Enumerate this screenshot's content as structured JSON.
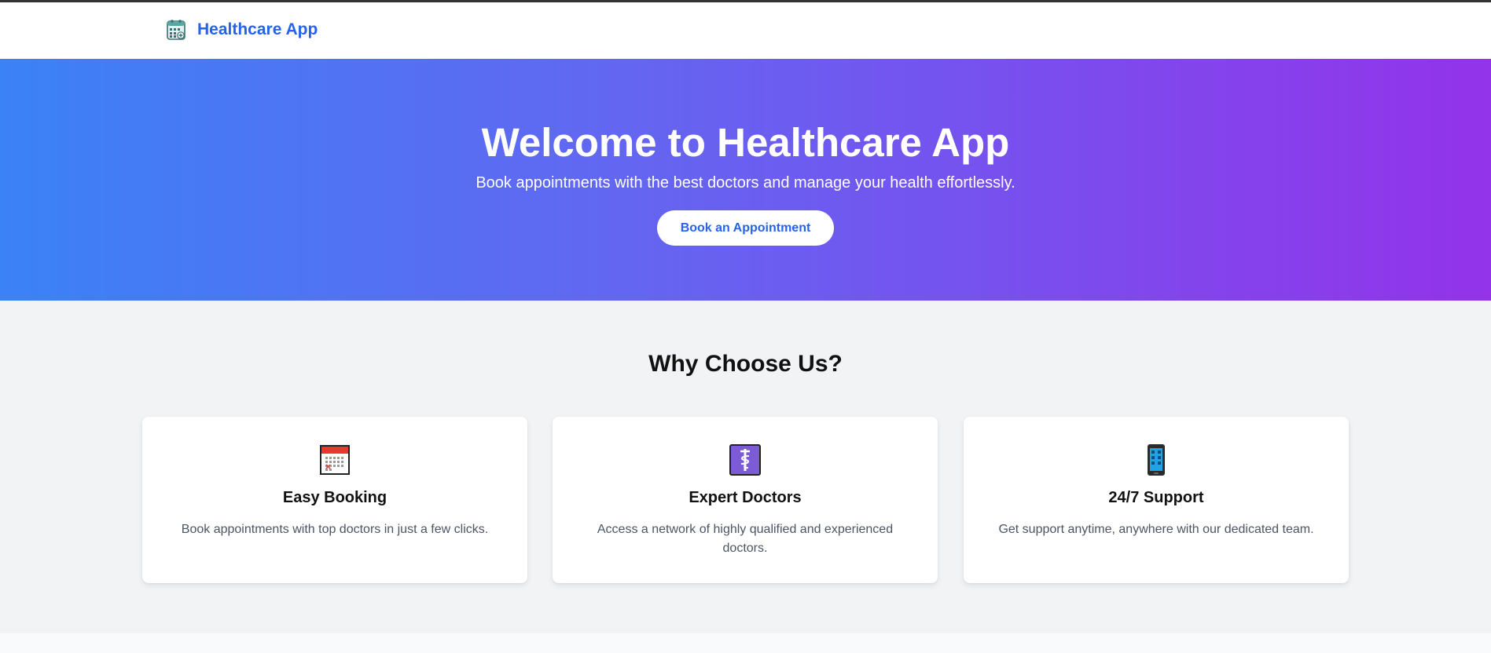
{
  "header": {
    "brand_name": "Healthcare App",
    "brand_icon": "hospital-calendar-icon"
  },
  "hero": {
    "title": "Welcome to Healthcare App",
    "subtitle": "Book appointments with the best doctors and manage your health effortlessly.",
    "cta_label": "Book an Appointment",
    "gradient_start": "#3b82f6",
    "gradient_end": "#9333ea"
  },
  "features": {
    "title": "Why Choose Us?",
    "items": [
      {
        "icon": "calendar-icon",
        "title": "Easy Booking",
        "text": "Book appointments with top doctors in just a few clicks."
      },
      {
        "icon": "medical-symbol-icon",
        "title": "Expert Doctors",
        "text": "Access a network of highly qualified and experienced doctors."
      },
      {
        "icon": "mobile-phone-icon",
        "title": "24/7 Support",
        "text": "Get support anytime, anywhere with our dedicated team."
      }
    ]
  },
  "colors": {
    "brand": "#2563eb",
    "section_bg": "#f1f3f5",
    "card_bg": "#ffffff"
  }
}
